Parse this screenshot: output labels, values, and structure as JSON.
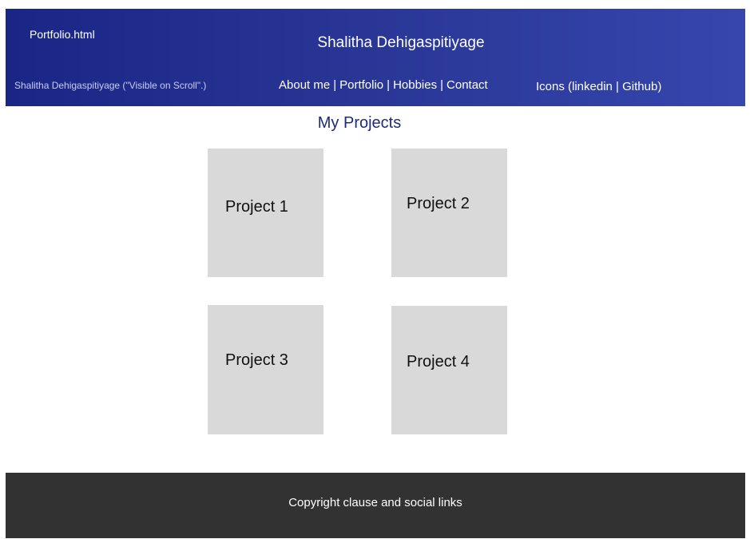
{
  "header": {
    "file_label": "Portfolio.html",
    "title": "Shalitha Dehigaspitiyage",
    "scroll_name": "Shalitha Dehigaspitiyage (\"Visible on Scroll\".)",
    "nav": {
      "about": "About me",
      "portfolio": "Portfolio",
      "hobbies": "Hobbies",
      "contact": "Contact",
      "separator": "|"
    },
    "social": {
      "prefix": "Icons (",
      "linkedin": "linkedin",
      "separator": " | ",
      "github": "Github",
      "suffix": ")"
    }
  },
  "main": {
    "section_title": "My Projects",
    "projects": [
      {
        "label": "Project 1"
      },
      {
        "label": "Project 2"
      },
      {
        "label": "Project 3"
      },
      {
        "label": "Project 4"
      }
    ]
  },
  "footer": {
    "text": "Copyright clause and social links"
  },
  "colors": {
    "header_gradient_start": "#1a2686",
    "header_gradient_end": "#3646ad",
    "section_title": "#1f2a78",
    "card_background": "#d9d9d9",
    "footer_background": "#323232"
  }
}
